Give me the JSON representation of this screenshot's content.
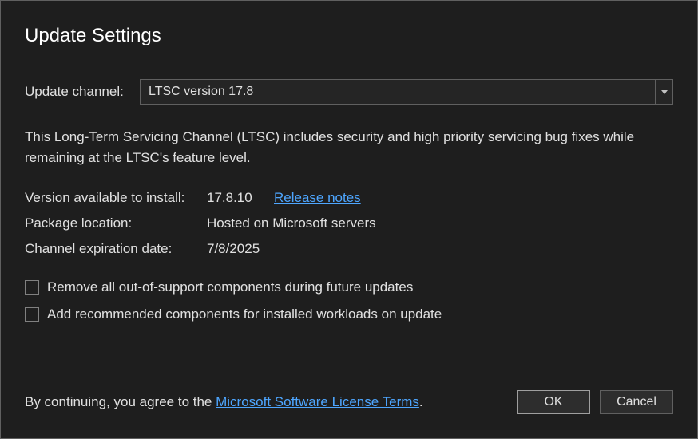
{
  "title": "Update Settings",
  "channel": {
    "label": "Update channel:",
    "selected": "LTSC version 17.8"
  },
  "description": "This Long-Term Servicing Channel (LTSC) includes security and high priority servicing bug fixes while remaining at the LTSC's feature level.",
  "info": {
    "version_available_label": "Version available to install:",
    "version_available_value": "17.8.10",
    "release_notes": "Release notes",
    "package_location_label": "Package location:",
    "package_location_value": "Hosted on Microsoft servers",
    "expiration_label": "Channel expiration date:",
    "expiration_value": "7/8/2025"
  },
  "checkboxes": {
    "remove_components": "Remove all out-of-support components during future updates",
    "add_recommended": "Add recommended components for installed workloads on update"
  },
  "footer": {
    "agree_prefix": "By continuing, you agree to the ",
    "license_link": "Microsoft Software License Terms",
    "agree_suffix": ".",
    "ok": "OK",
    "cancel": "Cancel"
  }
}
